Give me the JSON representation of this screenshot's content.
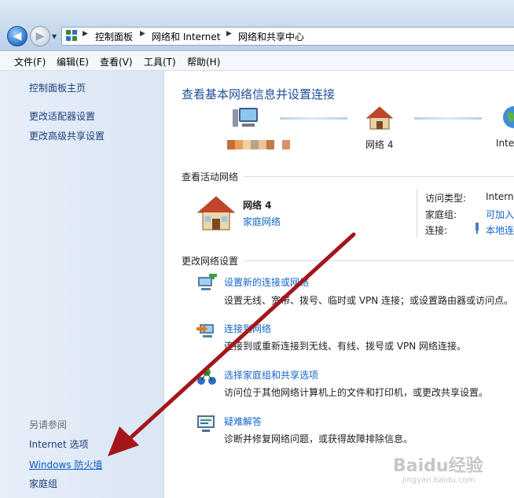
{
  "breadcrumb": {
    "items": [
      "控制面板",
      "网络和 Internet",
      "网络和共享中心"
    ]
  },
  "menu": [
    "文件(F)",
    "编辑(E)",
    "查看(V)",
    "工具(T)",
    "帮助(H)"
  ],
  "sidebar": {
    "links": [
      "控制面板主页",
      "更改适配器设置",
      "更改高级共享设置"
    ],
    "see_also_title": "另请参阅",
    "see_also": [
      "Internet 选项",
      "Windows 防火墙",
      "家庭组"
    ]
  },
  "main": {
    "title": "查看基本网络信息并设置连接",
    "map": {
      "network_label": "网络  4",
      "internet_label": "Inte"
    },
    "active_section": "查看活动网络",
    "active": {
      "name": "网络  4",
      "type": "家庭网络",
      "access_type_label": "访问类型:",
      "access_type_value": "Interne",
      "homegroup_label": "家庭组:",
      "homegroup_value": "可加入",
      "connection_label": "连接:",
      "connection_value": "本地连"
    },
    "change_section": "更改网络设置",
    "tasks": [
      {
        "title": "设置新的连接或网络",
        "desc": "设置无线、宽带、拨号、临时或 VPN 连接；或设置路由器或访问点。"
      },
      {
        "title": "连接到网络",
        "desc": "连接到或重新连接到无线、有线、拨号或 VPN 网络连接。"
      },
      {
        "title": "选择家庭组和共享选项",
        "desc": "访问位于其他网络计算机上的文件和打印机，或更改共享设置。"
      },
      {
        "title": "疑难解答",
        "desc": "诊断并修复网络问题，或获得故障排除信息。"
      }
    ]
  },
  "watermark": {
    "text": "Baidu经验",
    "sub": "jingyan.baidu.com"
  }
}
